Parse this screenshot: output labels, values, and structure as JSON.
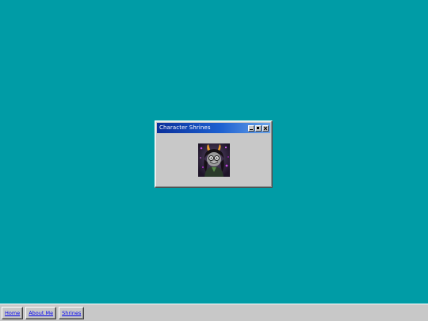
{
  "window": {
    "title": "Character Shrines"
  },
  "taskbar": {
    "links": [
      {
        "label": "Home"
      },
      {
        "label": "About Me"
      },
      {
        "label": "Shrines"
      }
    ]
  },
  "colors": {
    "desktop": "#009ca6",
    "titlebar_start": "#0a2f9a",
    "titlebar_end": "#6aa4ea",
    "panel": "#c8c8c8",
    "link": "#0000ee"
  },
  "icons": [
    "minimize-icon",
    "maximize-icon",
    "close-icon"
  ]
}
